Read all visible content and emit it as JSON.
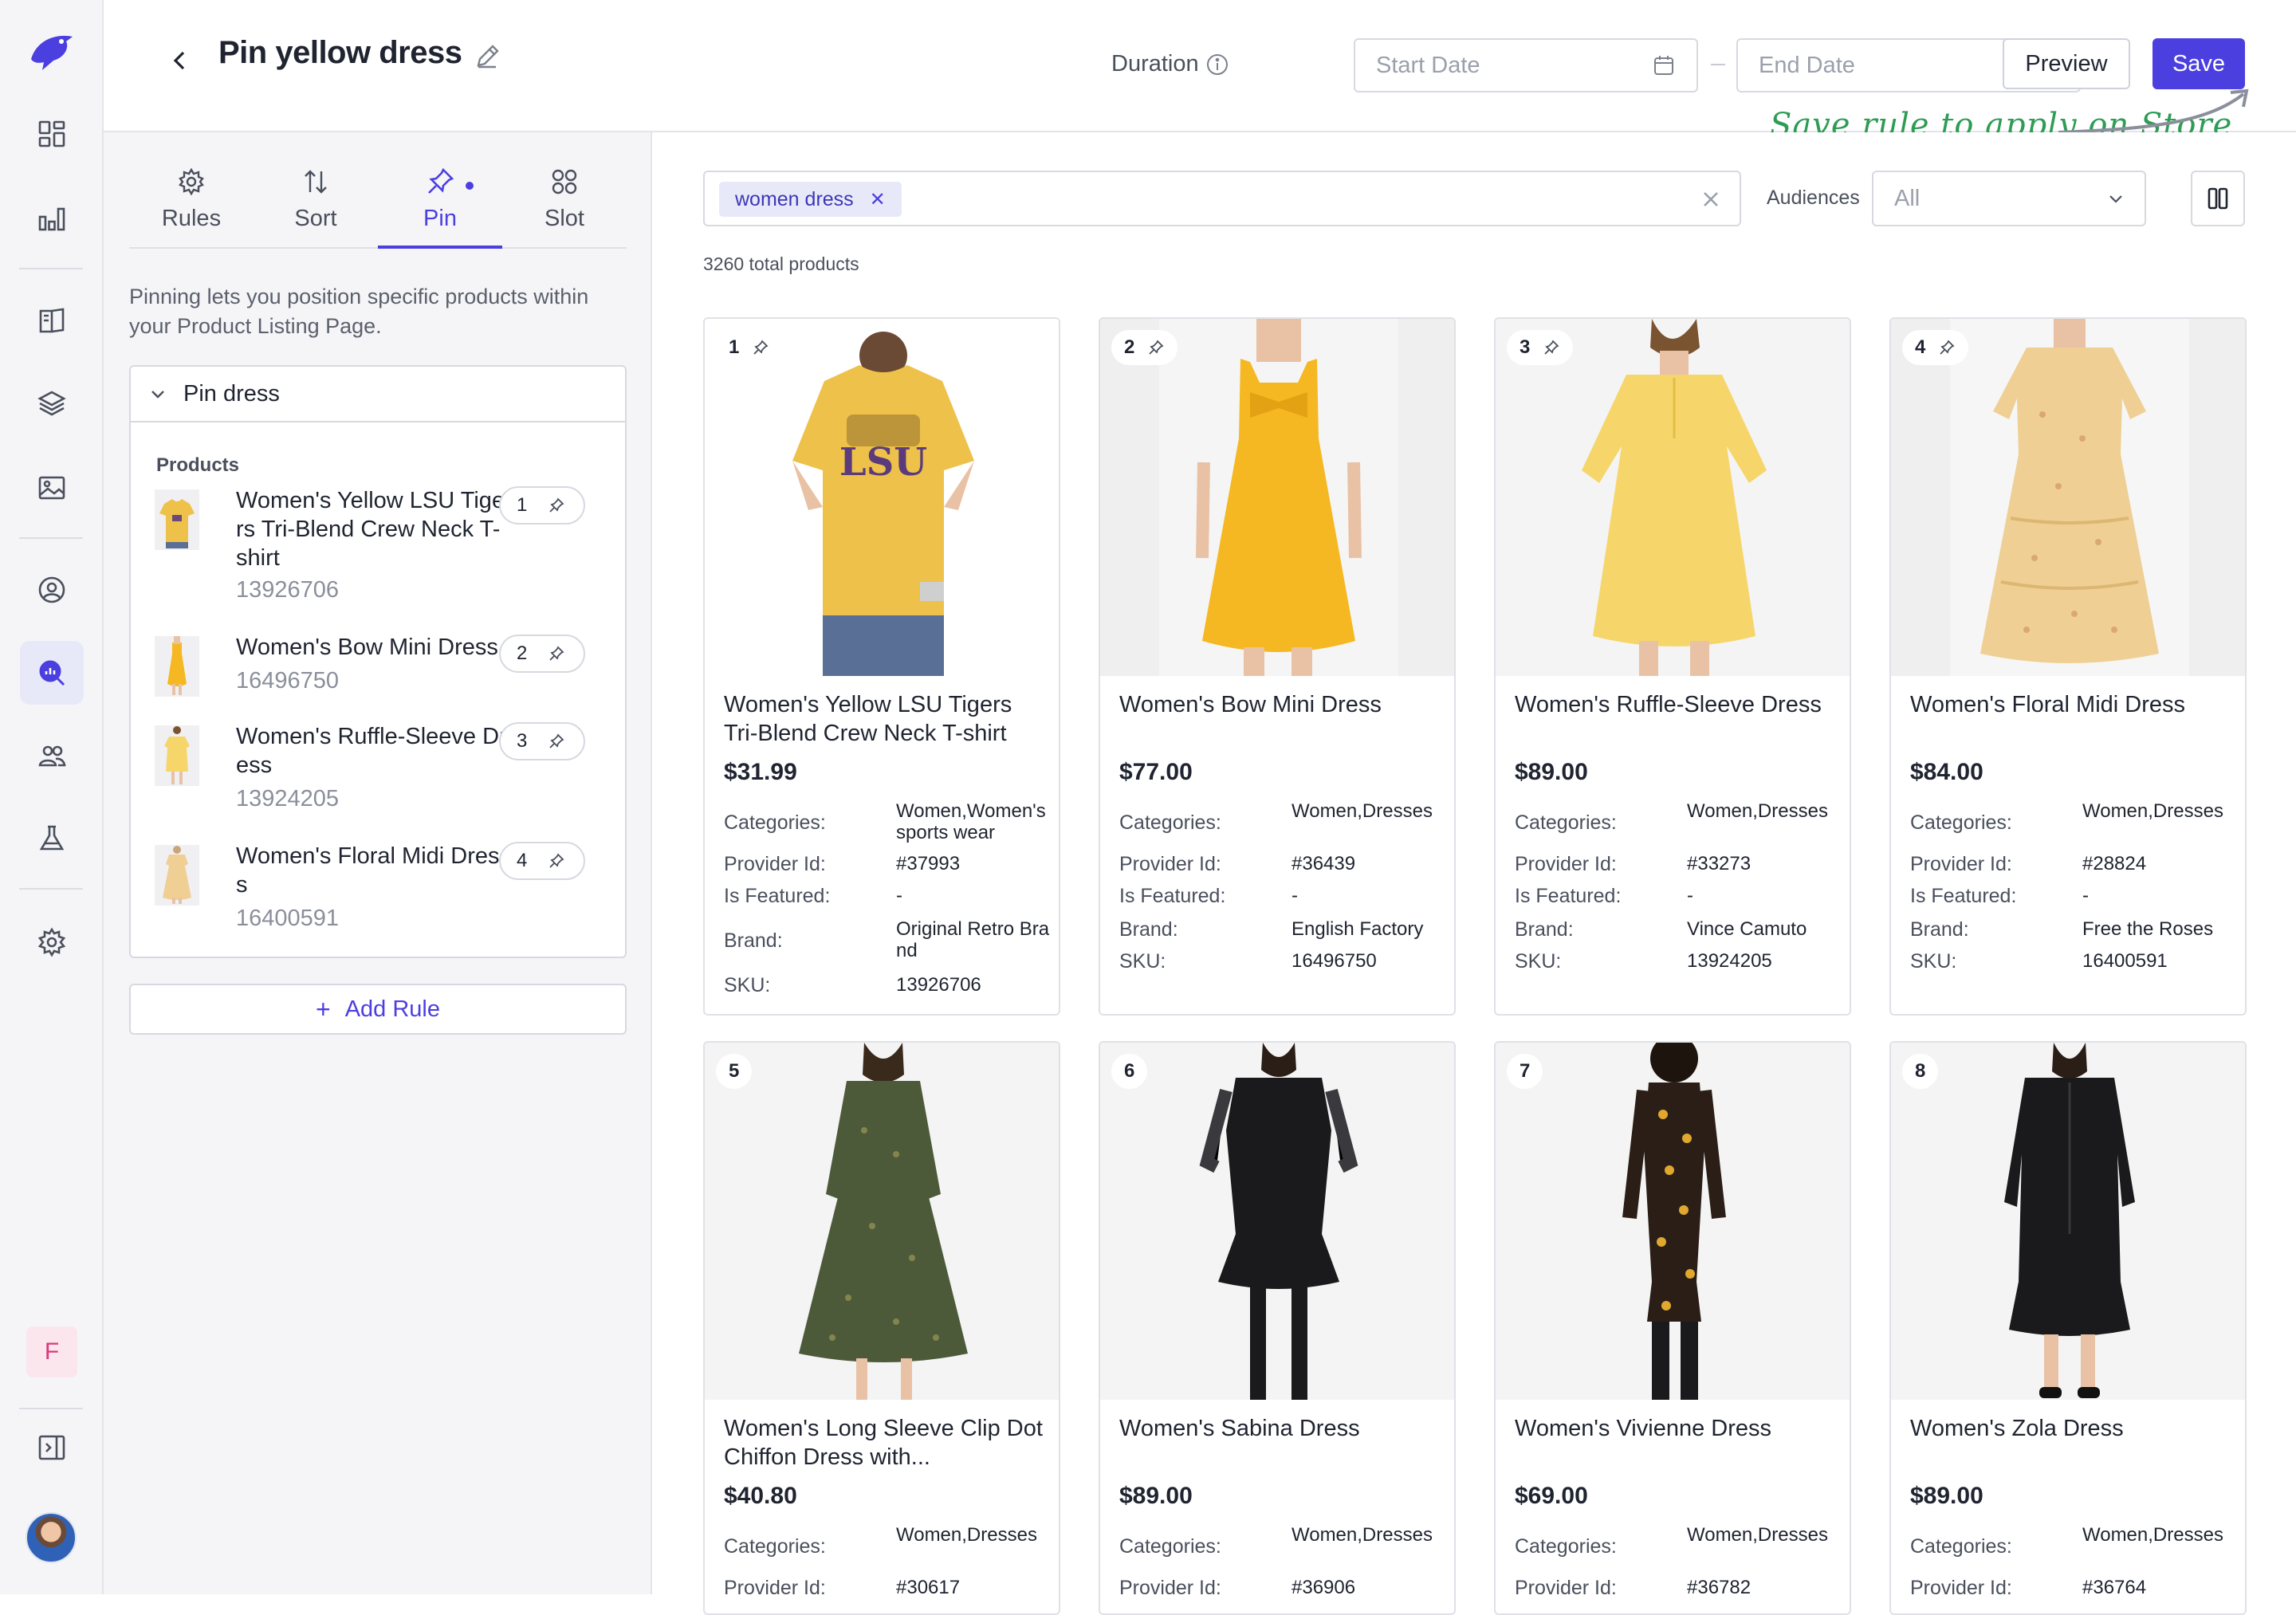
{
  "header": {
    "title": "Pin yellow dress",
    "duration_label": "Duration",
    "start_placeholder": "Start Date",
    "end_placeholder": "End Date",
    "preview_label": "Preview",
    "save_label": "Save",
    "annotation": "Save rule to apply on Store"
  },
  "rail": {
    "items": [
      "layout-grid-icon",
      "bar-chart-icon",
      "book-icon",
      "layers-icon",
      "image-icon",
      "user-circle-icon",
      "search-analytics-icon",
      "users-icon",
      "flask-icon",
      "gear-icon"
    ],
    "user_initial": "F"
  },
  "panel": {
    "tabs": [
      {
        "label": "Rules",
        "icon": "gear-icon"
      },
      {
        "label": "Sort",
        "icon": "sort-icon"
      },
      {
        "label": "Pin",
        "icon": "pin-icon",
        "active": true
      },
      {
        "label": "Slot",
        "icon": "grid-dots-icon"
      }
    ],
    "description": "Pinning lets you position specific products within your Product Listing Page.",
    "group_title": "Pin dress",
    "products_label": "Products",
    "products": [
      {
        "name": "Women's Yellow LSU Tigers Tri-Blend Crew Neck T-shirt",
        "id": "13926706",
        "position": "1"
      },
      {
        "name": "Women's Bow Mini Dress",
        "id": "16496750",
        "position": "2"
      },
      {
        "name": "Women's Ruffle-Sleeve Dress",
        "id": "13924205",
        "position": "3"
      },
      {
        "name": "Women's Floral Midi Dress",
        "id": "16400591",
        "position": "4"
      }
    ],
    "add_rule_label": "Add Rule"
  },
  "main": {
    "search_chip": "women dress",
    "audiences_label": "Audiences",
    "audiences_value": "All",
    "total_products": "3260 total products",
    "labels": {
      "categories": "Categories:",
      "provider": "Provider Id:",
      "featured": "Is Featured:",
      "brand": "Brand:",
      "sku": "SKU:"
    },
    "cards": [
      {
        "pos": "1",
        "pinned": true,
        "title": "Women's Yellow LSU Tigers Tri-Blend Crew Neck T-shirt",
        "price": "$31.99",
        "categories": "Women,Women's sports wear",
        "provider": "#37993",
        "featured": "-",
        "brand": "Original Retro Brand",
        "sku": "13926706"
      },
      {
        "pos": "2",
        "pinned": true,
        "title": "Women's Bow Mini Dress",
        "price": "$77.00",
        "categories": "Women,Dresses",
        "provider": "#36439",
        "featured": "-",
        "brand": "English Factory",
        "sku": "16496750"
      },
      {
        "pos": "3",
        "pinned": true,
        "title": "Women's Ruffle-Sleeve Dress",
        "price": "$89.00",
        "categories": "Women,Dresses",
        "provider": "#33273",
        "featured": "-",
        "brand": "Vince Camuto",
        "sku": "13924205"
      },
      {
        "pos": "4",
        "pinned": true,
        "title": "Women's Floral Midi Dress",
        "price": "$84.00",
        "categories": "Women,Dresses",
        "provider": "#28824",
        "featured": "-",
        "brand": "Free the Roses",
        "sku": "16400591"
      },
      {
        "pos": "5",
        "pinned": false,
        "title": "Women's Long Sleeve Clip Dot Chiffon Dress with...",
        "price": "$40.80",
        "categories": "Women,Dresses",
        "provider": "#30617"
      },
      {
        "pos": "6",
        "pinned": false,
        "title": "Women's Sabina Dress",
        "price": "$89.00",
        "categories": "Women,Dresses",
        "provider": "#36906"
      },
      {
        "pos": "7",
        "pinned": false,
        "title": "Women's Vivienne Dress",
        "price": "$69.00",
        "categories": "Women,Dresses",
        "provider": "#36782"
      },
      {
        "pos": "8",
        "pinned": false,
        "title": "Women's Zola Dress",
        "price": "$89.00",
        "categories": "Women,Dresses",
        "provider": "#36764"
      }
    ]
  },
  "colors": {
    "accent": "#4b3fe0",
    "annotation": "#2e9c55",
    "tshirt": "#eec14a",
    "bow_dress": "#f5b822",
    "ruffle_dress": "#f6d66a",
    "floral_dress": "#efcf93",
    "green_floral": "#4d5a3a",
    "black": "#1a1a1c"
  }
}
